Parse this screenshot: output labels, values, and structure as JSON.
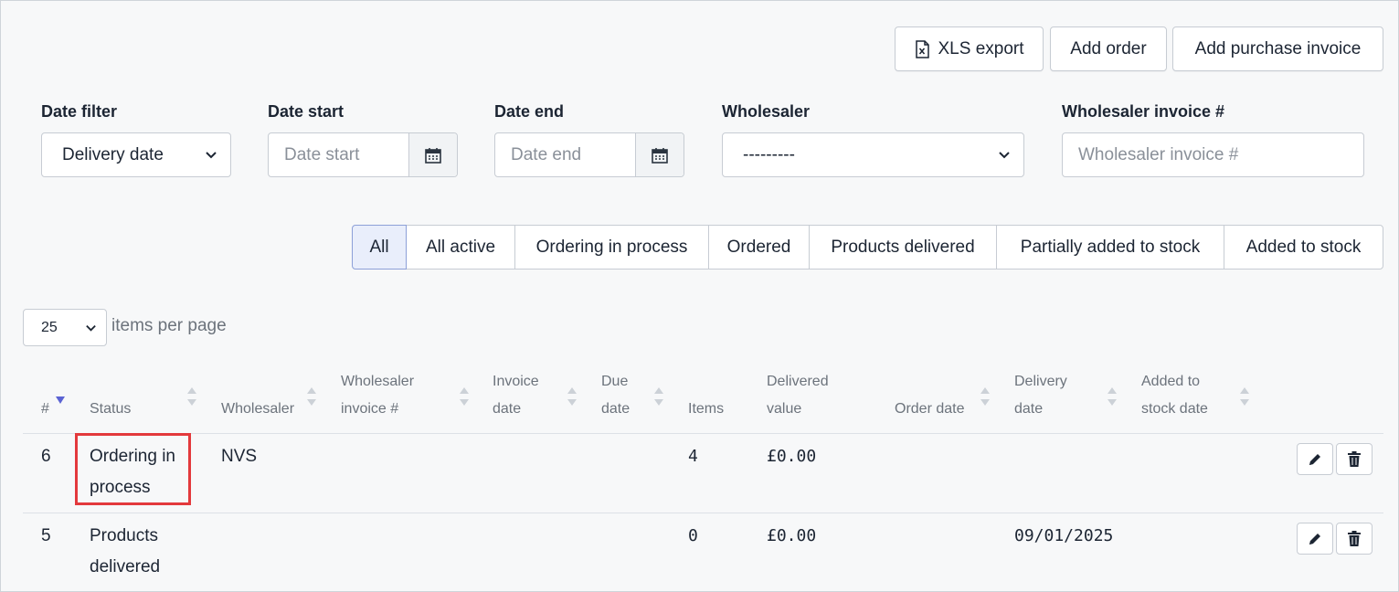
{
  "toolbar": {
    "xls_export": "XLS export",
    "add_order": "Add order",
    "add_purchase_invoice": "Add purchase invoice"
  },
  "filters": {
    "date_filter": {
      "label": "Date filter",
      "value": "Delivery date"
    },
    "date_start": {
      "label": "Date start",
      "placeholder": "Date start"
    },
    "date_end": {
      "label": "Date end",
      "placeholder": "Date end"
    },
    "wholesaler": {
      "label": "Wholesaler",
      "value": "---------"
    },
    "wholesaler_invoice": {
      "label": "Wholesaler invoice #",
      "placeholder": "Wholesaler invoice #"
    }
  },
  "status_tabs": [
    "All",
    "All active",
    "Ordering in process",
    "Ordered",
    "Products delivered",
    "Partially added to stock",
    "Added to stock"
  ],
  "active_tab": "All",
  "pagination": {
    "per_page": "25",
    "label": "items per page"
  },
  "table": {
    "headers": {
      "num": "#",
      "status": "Status",
      "wholesaler": "Wholesaler",
      "wholesaler_invoice_1": "Wholesaler",
      "wholesaler_invoice_2": "invoice #",
      "invoice_date_1": "Invoice",
      "invoice_date_2": "date",
      "due_date_1": "Due",
      "due_date_2": "date",
      "items": "Items",
      "delivered_value_1": "Delivered",
      "delivered_value_2": "value",
      "order_date": "Order date",
      "delivery_date_1": "Delivery",
      "delivery_date_2": "date",
      "added_to_stock_1": "Added to",
      "added_to_stock_2": "stock date"
    },
    "rows": [
      {
        "num": "6",
        "status_1": "Ordering in",
        "status_2": "process",
        "wholesaler": "NVS",
        "items": "4",
        "delivered_value": "£0.00",
        "delivery_date": ""
      },
      {
        "num": "5",
        "status_1": "Products",
        "status_2": "delivered",
        "wholesaler": "",
        "items": "0",
        "delivered_value": "£0.00",
        "delivery_date": "09/01/2025"
      }
    ]
  },
  "colors": {
    "highlight": "#e3393c",
    "sort_active": "#5b63d3",
    "active_tab_bg": "#e9eefb"
  }
}
